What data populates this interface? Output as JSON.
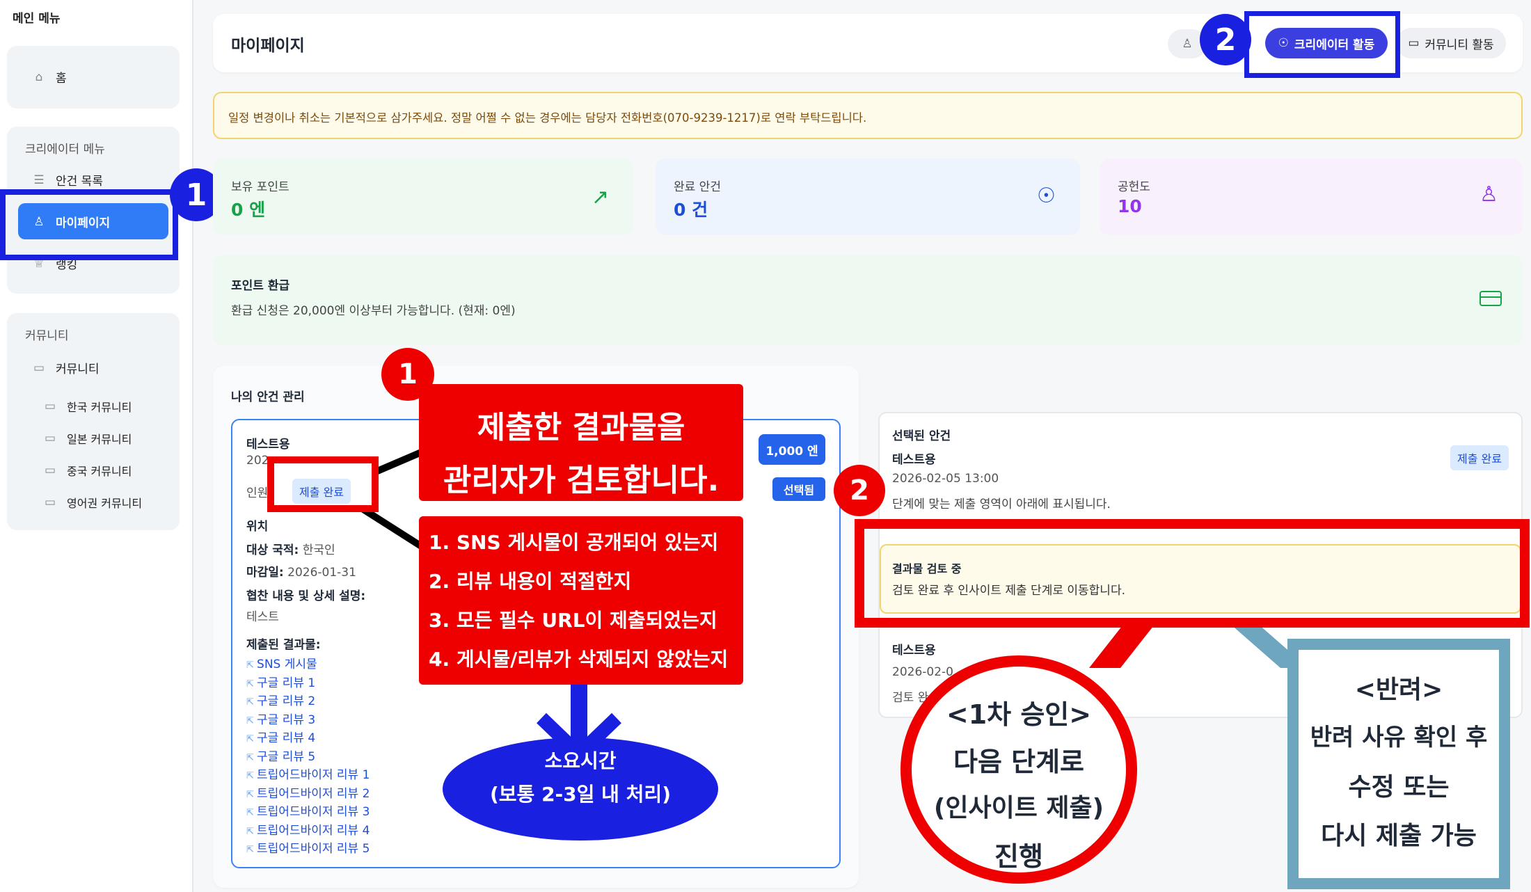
{
  "sidebar": {
    "title": "메인 메뉴",
    "home": "홈",
    "creator_menu": {
      "title": "크리에이터 메뉴",
      "items": [
        "안건 목록",
        "마이페이지",
        "랭킹"
      ]
    },
    "community": {
      "title": "커뮤니티",
      "main": "커뮤니티",
      "items": [
        "한국 커뮤니티",
        "일본 커뮤니티",
        "중국 커뮤니티",
        "영어권 커뮤니티"
      ]
    }
  },
  "header": {
    "title": "마이페이지",
    "tabs": {
      "creator": "크리에이터 활동",
      "community": "커뮤니티 활동"
    }
  },
  "notice": "일정 변경이나 취소는 기본적으로 삼가주세요. 정말 어쩔 수 없는 경우에는 담당자 전화번호(070-9239-1217)로 연락 부탁드립니다.",
  "stats": [
    {
      "label": "보유 포인트",
      "value": "0 엔",
      "color": "#16a34a",
      "icon": "trending-up-icon"
    },
    {
      "label": "완료 안건",
      "value": "0 건",
      "color": "#1d4ed8",
      "icon": "award-icon"
    },
    {
      "label": "공헌도",
      "value": "10",
      "color": "#9333ea",
      "icon": "user-icon"
    }
  ],
  "refund": {
    "title": "포인트 환급",
    "text": "환급 신청은 20,000엔 이상부터 가능합니다. (현재: 0엔)"
  },
  "cases": {
    "title": "나의 안건 관리",
    "item": {
      "name": "테스트용",
      "date_partial": "202",
      "people_partial": "인원",
      "status": "제출 완료",
      "price": "1,000 엔",
      "selected": "선택됨",
      "location_partial": "위치",
      "nationality_label": "대상 국적:",
      "nationality": "한국인",
      "deadline_label": "마감일:",
      "deadline": "2026-01-31",
      "desc_label": "협찬 내용 및 상세 설명:",
      "desc": "테스트",
      "submitted_label": "제출된 결과물:",
      "links": [
        "SNS 게시물",
        "구글 리뷰 1",
        "구글 리뷰 2",
        "구글 리뷰 3",
        "구글 리뷰 4",
        "구글 리뷰 5",
        "트립어드바이저 리뷰 1",
        "트립어드바이저 리뷰 2",
        "트립어드바이저 리뷰 3",
        "트립어드바이저 리뷰 4",
        "트립어드바이저 리뷰 5"
      ]
    }
  },
  "selected": {
    "title": "선택된 안건",
    "name": "테스트용",
    "status": "제출 완료",
    "datetime": "2026-02-05 13:00",
    "hint": "단계에 맞는 제출 영역이 아래에 표시됩니다.",
    "review_title": "결과물 검토 중",
    "review_text": "검토 완료 후 인사이트 제출 단계로 이동합니다.",
    "lower_name": "테스트용",
    "lower_date": "2026-02-0",
    "lower_text": "검토 완"
  },
  "annotations": {
    "badge1": "1",
    "badge2": "2",
    "title_line1": "제출한 결과물을",
    "title_line2": "관리자가 검토합니다.",
    "checks": [
      "1.  SNS 게시물이 공개되어 있는지",
      "2.  리뷰 내용이 적절한지",
      "3.  모든 필수 URL이 제출되었는지",
      "4.  게시물/리뷰가 삭제되지 않았는지"
    ],
    "time_line1": "소요시간",
    "time_line2": "(보통 2-3일 내 처리)",
    "approve": [
      "<1차 승인>",
      "다음 단계로",
      "(인사이트 제출)",
      "진행"
    ],
    "reject": [
      "<반려>",
      "반려 사유 확인 후",
      "수정 또는",
      "다시 제출 가능"
    ]
  },
  "colors": {
    "accent_blue": "#2563eb",
    "annotation_red": "#ee0000",
    "annotation_blue": "#1a20e0",
    "annotation_steel": "#6ea6bf"
  }
}
